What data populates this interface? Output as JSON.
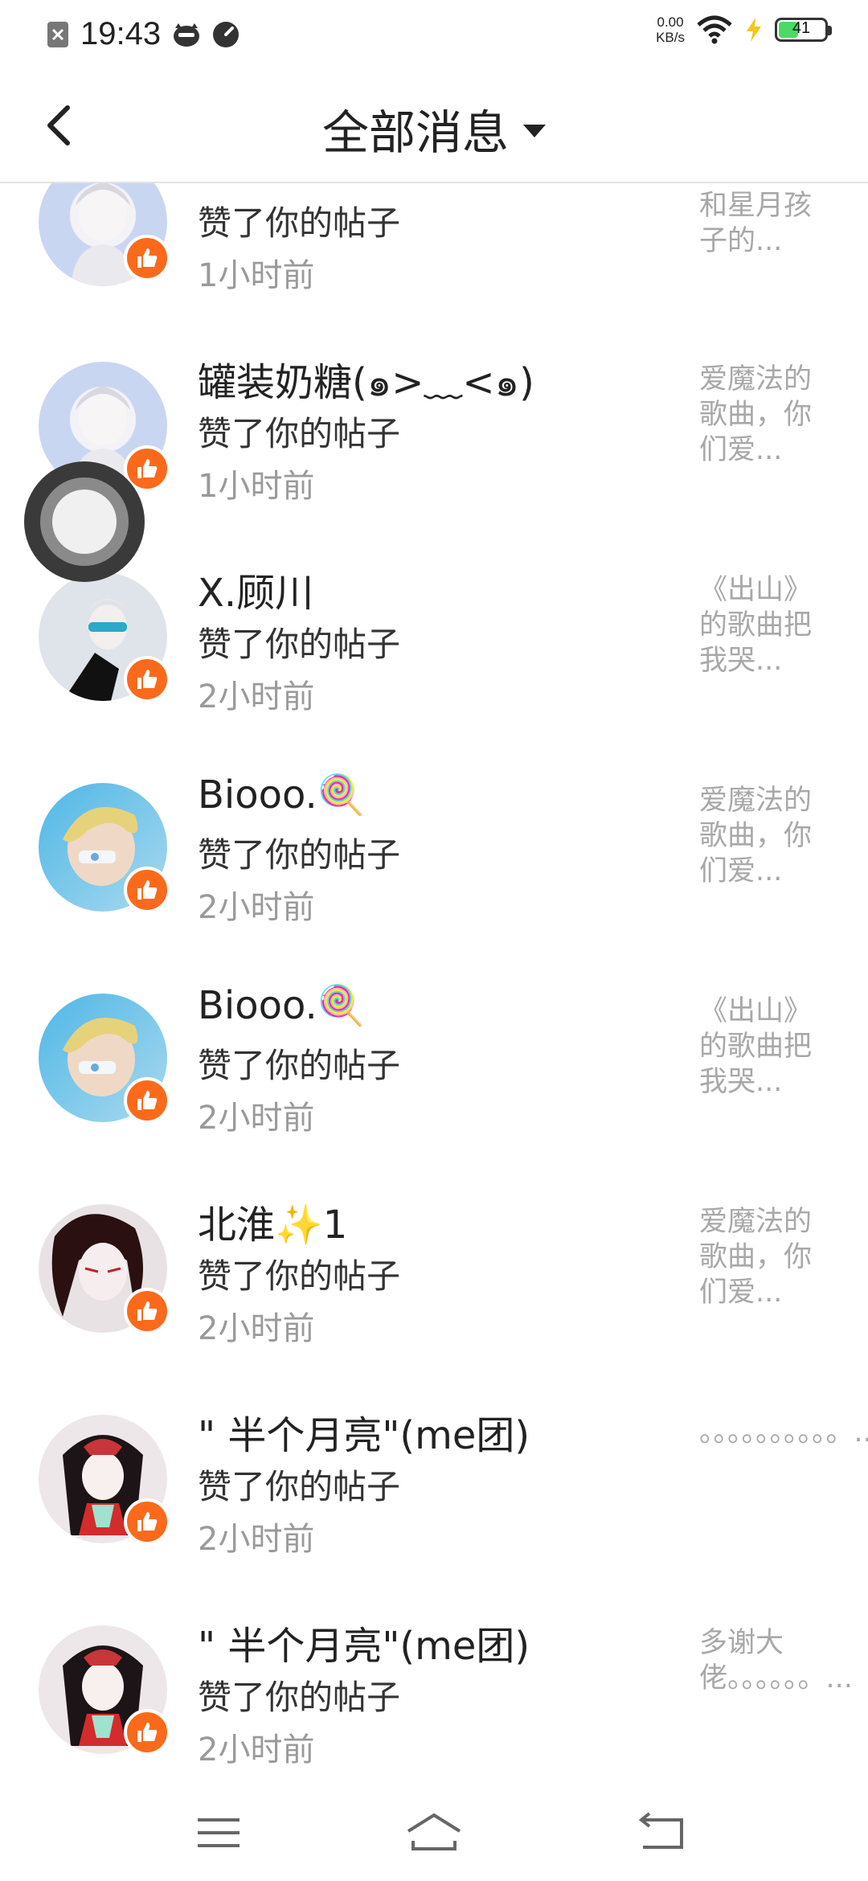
{
  "status_bar": {
    "time": "19:43",
    "net_speed_value": "0.00",
    "net_speed_unit": "KB/s",
    "battery_level": "41",
    "battery_color": "#4cd964"
  },
  "header": {
    "title": "全部消息",
    "back_icon": "chevron-left-icon",
    "dropdown_icon": "caret-down-icon"
  },
  "messages": [
    {
      "name": "",
      "action": "赞了你的帖子",
      "time": "1小时前",
      "preview": "和星月孩子的..."
    },
    {
      "name": "罐装奶糖(๑>﹏<๑)",
      "action": "赞了你的帖子",
      "time": "1小时前",
      "preview": "爱魔法的歌曲，你们爱..."
    },
    {
      "name": "X.顾川",
      "action": "赞了你的帖子",
      "time": "2小时前",
      "preview": "《出山》的歌曲把我哭..."
    },
    {
      "name": "Biooo.🍭",
      "action": "赞了你的帖子",
      "time": "2小时前",
      "preview": "爱魔法的歌曲，你们爱..."
    },
    {
      "name": "Biooo.🍭",
      "action": "赞了你的帖子",
      "time": "2小时前",
      "preview": "《出山》的歌曲把我哭..."
    },
    {
      "name": "北淮✨1",
      "action": "赞了你的帖子",
      "time": "2小时前",
      "preview": "爱魔法的歌曲，你们爱..."
    },
    {
      "name": "\" 半个月亮\"(me团)",
      "action": "赞了你的帖子",
      "time": "2小时前",
      "preview": "。。。。。。。。。。..."
    },
    {
      "name": "\" 半个月亮\"(me团)",
      "action": "赞了你的帖子",
      "time": "2小时前",
      "preview": "多谢大佬。。。。。。..."
    }
  ],
  "colors": {
    "like_badge": "#fb6a1b",
    "secondary_text": "#9a9a9a"
  },
  "navbar": {
    "items": [
      "menu-icon",
      "home-icon",
      "back-icon"
    ]
  }
}
